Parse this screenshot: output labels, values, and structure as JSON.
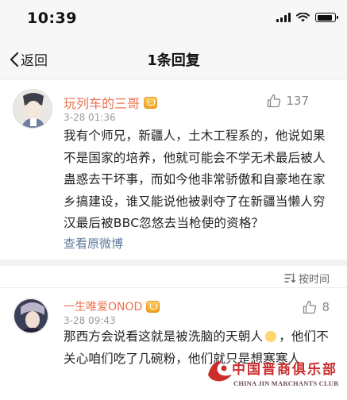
{
  "status_bar": {
    "time": "10:39",
    "battery_level": 0.9
  },
  "nav": {
    "back_label": "返回",
    "title": "1条回复"
  },
  "post": {
    "username": "玩列车的三哥",
    "timestamp": "3-28 01:36",
    "likes": "137",
    "content": "我有个师兄，新疆人，土木工程系的，他说如果不是国家的培养，他就可能会不学无术最后被人蛊惑去干坏事，而如今他非常骄傲和自豪地在家乡搞建设，谁又能说他被剥夺了在新疆当懒人穷汉最后被BBC忽悠去当枪使的资格？",
    "view_original": "查看原微博"
  },
  "sort": {
    "label": "按时间"
  },
  "reply": {
    "username": "一生唯爱ONOD",
    "timestamp": "3-28 09:43",
    "likes": "8",
    "content_part1": "那西方会说看这就是被洗脑的天朝人",
    "content_part2": "，他们不关心咱们吃了几碗粉，他们就只是想寒寒人"
  },
  "watermark": {
    "cn": "中国晋商俱乐部",
    "en": "CHINA JIN MARCHANTS CLUB"
  },
  "colors": {
    "username": "#eb7350",
    "link": "#5b7a9b",
    "watermark_red": "#c81c1c"
  },
  "icons": [
    "signal-icon",
    "wifi-icon",
    "battery-icon",
    "back-chevron-icon",
    "vip-badge-icon",
    "like-icon",
    "sort-icon",
    "emoji-icon",
    "club-emblem-icon"
  ]
}
